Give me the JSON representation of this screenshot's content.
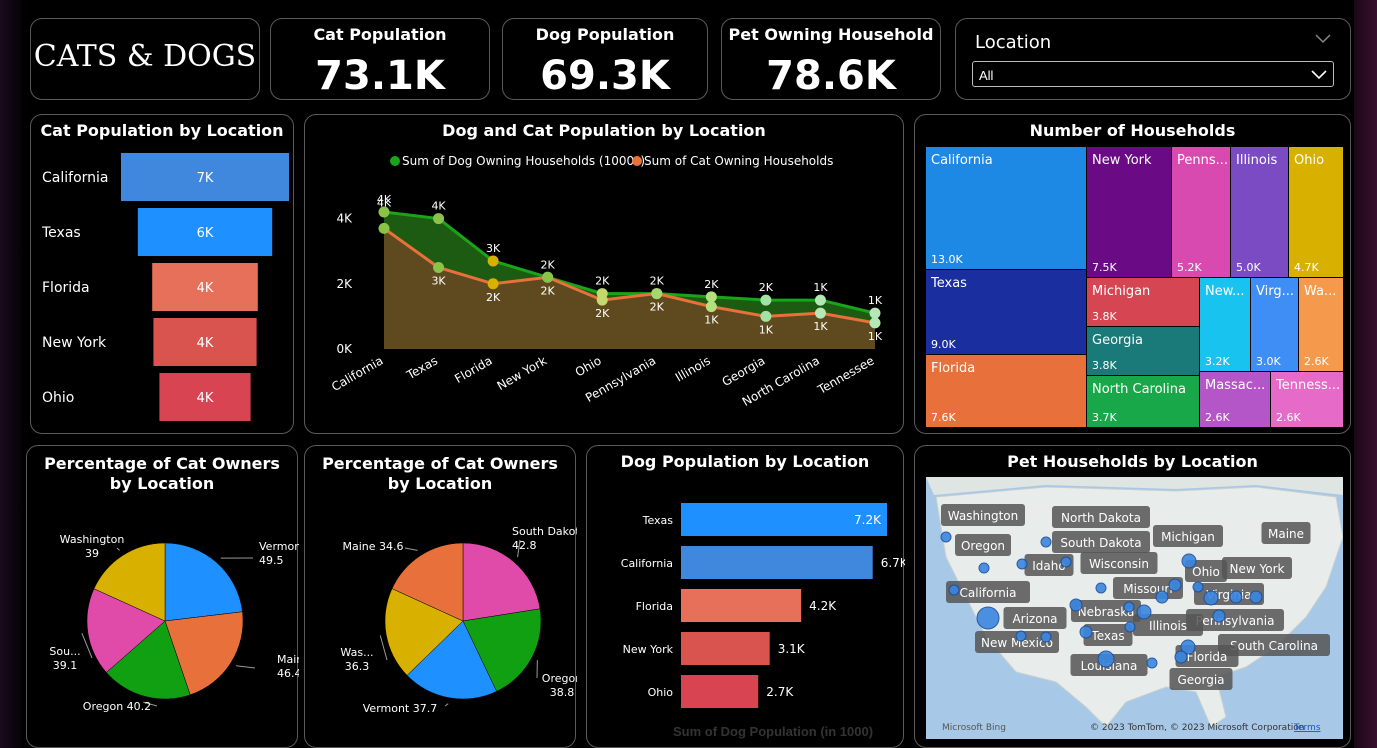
{
  "title": "CATS & DOGS",
  "kpis": {
    "cat": {
      "label": "Cat Population",
      "value": "73.1K"
    },
    "dog": {
      "label": "Dog Population",
      "value": "69.3K"
    },
    "hh": {
      "label": "Pet Owning Household",
      "value": "78.6K"
    }
  },
  "filter": {
    "label": "Location",
    "value": "All"
  },
  "cat_by_location": {
    "title": "Cat Population by Location",
    "rows": [
      {
        "name": "California",
        "label": "7K",
        "value": 7.0,
        "color": "#3f88de"
      },
      {
        "name": "Texas",
        "label": "6K",
        "value": 5.6,
        "color": "#1e90ff"
      },
      {
        "name": "Florida",
        "label": "4K",
        "value": 4.4,
        "color": "#e67059"
      },
      {
        "name": "New York",
        "label": "4K",
        "value": 4.3,
        "color": "#d9534f"
      },
      {
        "name": "Ohio",
        "label": "4K",
        "value": 3.8,
        "color": "#d94452"
      }
    ]
  },
  "dog_cat_line": {
    "title": "Dog and Cat Population by Location",
    "legend": [
      {
        "name": "Sum of Dog Owning Households (1000s)",
        "color": "#19a419"
      },
      {
        "name": "Sum of Cat Owning Households",
        "color": "#e8703a"
      }
    ],
    "categories": [
      "California",
      "Texas",
      "Florida",
      "New York",
      "Ohio",
      "Pennsylvania",
      "Illinois",
      "Georgia",
      "North Carolina",
      "Tennessee"
    ],
    "dog": [
      4.2,
      4.0,
      2.7,
      2.2,
      1.7,
      1.7,
      1.6,
      1.5,
      1.5,
      1.1
    ],
    "cat": [
      3.7,
      2.5,
      2.0,
      2.2,
      1.5,
      1.7,
      1.3,
      1.0,
      1.1,
      0.8
    ],
    "dog_labels": [
      "4K",
      "4K",
      "3K",
      "2K",
      "2K",
      "2K",
      "2K",
      "2K",
      "1K",
      "1K"
    ],
    "cat_labels": [
      "4K",
      "3K",
      "2K",
      "2K",
      "2K",
      "2K",
      "1K",
      "1K",
      "1K",
      "1K"
    ],
    "yticks": [
      "0K",
      "2K",
      "4K"
    ]
  },
  "households": {
    "title": "Number of Households",
    "cells": [
      {
        "name": "California",
        "label": "13.0K",
        "color": "#1e88e5"
      },
      {
        "name": "New York",
        "label": "7.5K",
        "color": "#6a0a85"
      },
      {
        "name": "Penns...",
        "label": "5.2K",
        "color": "#d94ab0"
      },
      {
        "name": "Illinois",
        "label": "5.0K",
        "color": "#7a4bc2"
      },
      {
        "name": "Ohio",
        "label": "4.7K",
        "color": "#d8b000"
      },
      {
        "name": "Texas",
        "label": "9.0K",
        "color": "#1a2ea0"
      },
      {
        "name": "Michigan",
        "label": "3.8K",
        "color": "#d64552"
      },
      {
        "name": "New...",
        "label": "3.2K",
        "color": "#19c3f0"
      },
      {
        "name": "Virg...",
        "label": "3.0K",
        "color": "#3f8ef5"
      },
      {
        "name": "Wa...",
        "label": "2.6K",
        "color": "#f59a4c"
      },
      {
        "name": "Georgia",
        "label": "3.8K",
        "color": "#1a7a7a"
      },
      {
        "name": "Florida",
        "label": "7.6K",
        "color": "#e8703a"
      },
      {
        "name": "North Carolina",
        "label": "3.7K",
        "color": "#18a84a"
      },
      {
        "name": "Massac...",
        "label": "2.6K",
        "color": "#b455c8"
      },
      {
        "name": "Tenness...",
        "label": "2.6K",
        "color": "#e66ac8"
      }
    ]
  },
  "pie1": {
    "title_line1": "Percentage of Cat Owners",
    "title_line2": "by Location",
    "slices": [
      {
        "name": "Vermont",
        "value": 49.5,
        "label": "49.5",
        "color": "#1e90ff"
      },
      {
        "name": "Maine",
        "value": 46.4,
        "label": "46.4",
        "color": "#e8703a"
      },
      {
        "name": "Oregon",
        "value": 40.2,
        "label": "40.2",
        "color": "#11a011"
      },
      {
        "name": "Sou...",
        "value": 39.1,
        "label": "39.1",
        "color": "#e04aa8"
      },
      {
        "name": "Washington",
        "value": 39,
        "label": "39",
        "color": "#d8b000"
      }
    ]
  },
  "pie2": {
    "title_line1": "Percentage of Cat Owners",
    "title_line2": "by Location",
    "slices": [
      {
        "name": "South Dakota",
        "value": 42.8,
        "label": "42.8",
        "color": "#e04aa8"
      },
      {
        "name": "Oregon",
        "value": 38.8,
        "label": "38.8",
        "color": "#11a011"
      },
      {
        "name": "Vermont",
        "value": 37.7,
        "label": "37.7",
        "color": "#1e90ff"
      },
      {
        "name": "Was...",
        "value": 36.3,
        "label": "36.3",
        "color": "#d8b000"
      },
      {
        "name": "Maine",
        "value": 34.6,
        "label": "34.6",
        "color": "#e8703a"
      }
    ]
  },
  "dog_by_location": {
    "title": "Dog Population by Location",
    "axis_title": "Sum of Dog Population (in 1000)",
    "rows": [
      {
        "name": "Texas",
        "label": "7.2K",
        "value": 7.2,
        "color": "#1e90ff"
      },
      {
        "name": "California",
        "label": "6.7K",
        "value": 6.7,
        "color": "#3f88de"
      },
      {
        "name": "Florida",
        "label": "4.2K",
        "value": 4.2,
        "color": "#e67059"
      },
      {
        "name": "New York",
        "label": "3.1K",
        "value": 3.1,
        "color": "#d9534f"
      },
      {
        "name": "Ohio",
        "label": "2.7K",
        "value": 2.7,
        "color": "#d94452"
      }
    ]
  },
  "map": {
    "title": "Pet Households by Location",
    "labels": [
      "Washington",
      "North Dakota",
      "Maine",
      "Oregon",
      "South Dakota",
      "Michigan",
      "Idaho",
      "Wisconsin",
      "Ohio",
      "New York",
      "California",
      "Missouri",
      "Virginia",
      "Nebraska",
      "Arizona",
      "Pennsylvania",
      "Illinois",
      "Texas",
      "New Mexico",
      "South Carolina",
      "Louisiana",
      "Florida",
      "Georgia"
    ],
    "bing": "Microsoft Bing",
    "copyright": "© 2023 TomTom, © 2023 Microsoft Corporation",
    "terms": "Terms"
  }
}
